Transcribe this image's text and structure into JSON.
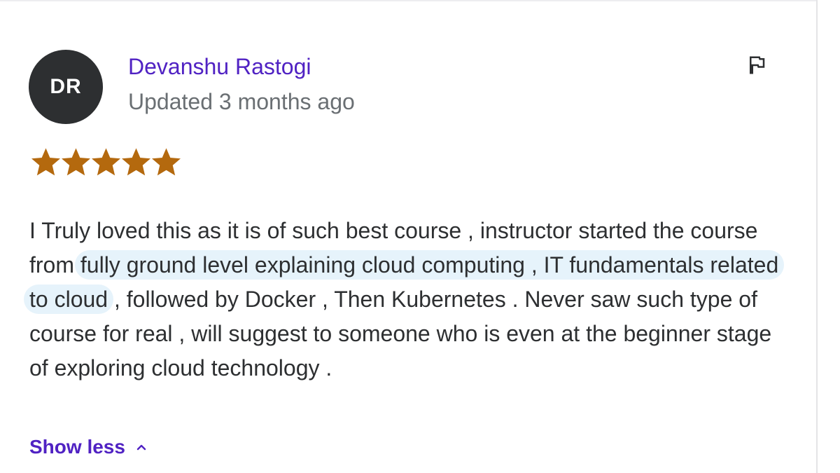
{
  "review": {
    "avatar_initials": "DR",
    "reviewer_name": "Devanshu Rastogi",
    "date_text": "Updated 3 months ago",
    "rating": 5,
    "rating_max": 5,
    "star_color": "#b4690e",
    "text_before": "I Truly loved this as it is of such best course , instructor started the course from ",
    "text_highlighted": "fully ground level explaining cloud computing , IT fundamentals related to cloud",
    "text_after": ", followed by Docker , Then Kubernetes . Never saw such type of course for real , will suggest to someone who is even at the beginner stage of exploring cloud technology .",
    "highlight_color": "#e6f3fb"
  },
  "actions": {
    "flag_icon": "flag-icon",
    "show_less_label": "Show less",
    "show_less_icon": "chevron-up-icon"
  },
  "colors": {
    "accent": "#5022c3",
    "avatar_bg": "#2d2f31",
    "muted_text": "#6a6f73",
    "body_text": "#2d2f31"
  }
}
